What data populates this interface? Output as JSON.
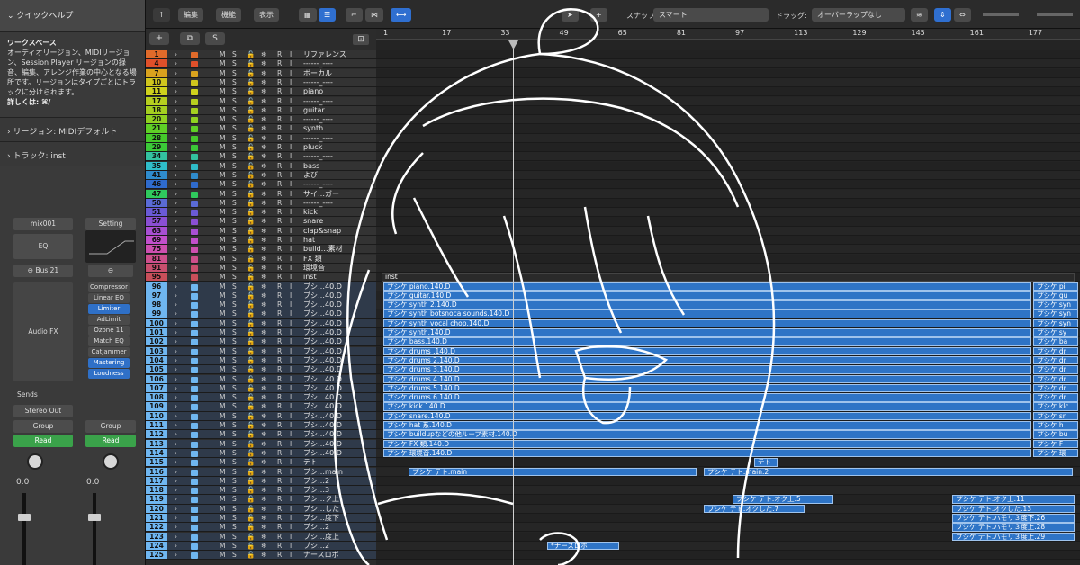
{
  "help": {
    "header": "クイックヘルプ",
    "title": "ワークスペース",
    "text": "オーディオリージョン、MIDIリージョン、Session Player リージョンの録音、編集、アレンジ作業の中心となる場所です。リージョンはタイプごとにトラックに分けられます。",
    "more": "詳しくは: ⌘/",
    "region_section": "リージョン: MIDIデフォルト",
    "track_section": "トラック: inst"
  },
  "strip1": {
    "name": "mix001",
    "eq": "EQ",
    "bus": "Bus 21",
    "fx": "Audio FX",
    "sends": "Sends",
    "out": "Stereo Out",
    "group": "Group",
    "mode": "Read",
    "value": "0.0"
  },
  "strip2": {
    "setting": "Setting",
    "plugins": [
      "Compressor",
      "Linear EQ",
      "Limiter",
      "AdLimit",
      "Ozone 11",
      "Match EQ",
      "CatJammer",
      "Mastering",
      "Loudness"
    ],
    "plugins_active": [
      false,
      false,
      true,
      false,
      false,
      false,
      false,
      true,
      true
    ],
    "group": "Group",
    "mode": "Read",
    "value": "0.0"
  },
  "toolbar": {
    "edit": "編集",
    "func": "機能",
    "view": "表示",
    "snap_label": "スナップ:",
    "snap_value": "スマート",
    "drag_label": "ドラッグ:",
    "drag_value": "オーバーラップなし"
  },
  "ruler": [
    "1",
    "17",
    "33",
    "49",
    "65",
    "81",
    "97",
    "113",
    "129",
    "145",
    "161",
    "177"
  ],
  "tracks": [
    {
      "n": "1",
      "c": "#e06a2a",
      "name": "リファレンス"
    },
    {
      "n": "4",
      "c": "#e0502a",
      "name": "------_---- "
    },
    {
      "n": "7",
      "c": "#d9a21e",
      "name": "ボーカル"
    },
    {
      "n": "10",
      "c": "#cfc51d",
      "name": "------_----"
    },
    {
      "n": "11",
      "c": "#cfd21d",
      "name": "piano"
    },
    {
      "n": "17",
      "c": "#b6cf1f",
      "name": "------_----"
    },
    {
      "n": "18",
      "c": "#a4cf20",
      "name": "guitar"
    },
    {
      "n": "20",
      "c": "#8fd021",
      "name": "------_----"
    },
    {
      "n": "21",
      "c": "#5fcf26",
      "name": "synth"
    },
    {
      "n": "28",
      "c": "#45c92b",
      "name": "------_----"
    },
    {
      "n": "29",
      "c": "#3bc938",
      "name": "pluck"
    },
    {
      "n": "34",
      "c": "#33c2a0",
      "name": "------_----"
    },
    {
      "n": "35",
      "c": "#2fbdc9",
      "name": "bass"
    },
    {
      "n": "41",
      "c": "#2f8ccd",
      "name": "よび"
    },
    {
      "n": "46",
      "c": "#2f6bcd",
      "name": "------_----"
    },
    {
      "n": "47",
      "c": "#2fc95d",
      "name": "サイ…ガー"
    },
    {
      "n": "50",
      "c": "#5a6bd6",
      "name": "------_----"
    },
    {
      "n": "51",
      "c": "#6a5ad6",
      "name": "kick"
    },
    {
      "n": "57",
      "c": "#8a4fd3",
      "name": "snare"
    },
    {
      "n": "63",
      "c": "#a84fd3",
      "name": "clap&snap"
    },
    {
      "n": "69",
      "c": "#c24fcc",
      "name": "hat"
    },
    {
      "n": "75",
      "c": "#cd4fb0",
      "name": "build…素材"
    },
    {
      "n": "81",
      "c": "#cd4f8c",
      "name": "FX 類"
    },
    {
      "n": "91",
      "c": "#c84f6e",
      "name": "環境音"
    },
    {
      "n": "95",
      "c": "#c84f5a",
      "name": "inst"
    },
    {
      "n": "96",
      "c": "#6fb6f0",
      "name": "プシ…40.D"
    },
    {
      "n": "97",
      "c": "#6fb6f0",
      "name": "プシ…40.D"
    },
    {
      "n": "98",
      "c": "#6fb6f0",
      "name": "プシ…40.D"
    },
    {
      "n": "99",
      "c": "#6fb6f0",
      "name": "プシ…40.D"
    },
    {
      "n": "100",
      "c": "#6fb6f0",
      "name": "プシ…40.D"
    },
    {
      "n": "101",
      "c": "#6fb6f0",
      "name": "プシ…40.D"
    },
    {
      "n": "102",
      "c": "#6fb6f0",
      "name": "プシ…40.D"
    },
    {
      "n": "103",
      "c": "#6fb6f0",
      "name": "プシ…40.D"
    },
    {
      "n": "104",
      "c": "#6fb6f0",
      "name": "プシ…40.D"
    },
    {
      "n": "105",
      "c": "#6fb6f0",
      "name": "プシ…40.D"
    },
    {
      "n": "106",
      "c": "#6fb6f0",
      "name": "プシ…40.D"
    },
    {
      "n": "107",
      "c": "#6fb6f0",
      "name": "プシ…40.D"
    },
    {
      "n": "108",
      "c": "#6fb6f0",
      "name": "プシ…40.D"
    },
    {
      "n": "109",
      "c": "#6fb6f0",
      "name": "プシ…40.D"
    },
    {
      "n": "110",
      "c": "#6fb6f0",
      "name": "プシ…40.D"
    },
    {
      "n": "111",
      "c": "#6fb6f0",
      "name": "プシ…40.D"
    },
    {
      "n": "112",
      "c": "#6fb6f0",
      "name": "プシ…40.D"
    },
    {
      "n": "113",
      "c": "#6fb6f0",
      "name": "プシ…40.D"
    },
    {
      "n": "114",
      "c": "#6fb6f0",
      "name": "プシ…40.D"
    },
    {
      "n": "115",
      "c": "#6fb6f0",
      "name": "テト"
    },
    {
      "n": "116",
      "c": "#6fb6f0",
      "name": "プシ…main"
    },
    {
      "n": "117",
      "c": "#6fb6f0",
      "name": "プシ…2"
    },
    {
      "n": "118",
      "c": "#6fb6f0",
      "name": "プシ…3"
    },
    {
      "n": "119",
      "c": "#6fb6f0",
      "name": "プシ…ク上"
    },
    {
      "n": "120",
      "c": "#6fb6f0",
      "name": "プシ…した"
    },
    {
      "n": "121",
      "c": "#6fb6f0",
      "name": "プシ…度下"
    },
    {
      "n": "122",
      "c": "#6fb6f0",
      "name": "プシ…2"
    },
    {
      "n": "123",
      "c": "#6fb6f0",
      "name": "プシ…度上"
    },
    {
      "n": "124",
      "c": "#6fb6f0",
      "name": "プシ…2"
    },
    {
      "n": "125",
      "c": "#6fb6f0",
      "name": "ナースロボ"
    }
  ],
  "inst_label": "inst",
  "regions": [
    "プシケ piano.140.D",
    "プシケ guitar.140.D",
    "プシケ synth 2.140.D",
    "プシケ synth botsnoca sounds.140.D",
    "プシケ synth vocal chop.140.D",
    "プシケ synth.140.D",
    "プシケ bass.140.D",
    "プシケ drums .140.D",
    "プシケ drums 2.140.D",
    "プシケ drums 3.140.D",
    "プシケ drums 4.140.D",
    "プシケ drums 5.140.D",
    "プシケ drums 6.140.D",
    "プシケ kick.140.D",
    "プシケ snare.140.D",
    "プシケ hat 系.140.D",
    "プシケ buildupなどの他ループ素材.140.D",
    "プシケ FX 類.140.D",
    "プシケ 環境音.140.D"
  ],
  "tail_regions": [
    "プシケ pi",
    "プシケ gu",
    "プシケ syn",
    "プシケ syn",
    "プシケ syn",
    "プシケ sy",
    "プシケ ba",
    "プシケ dr",
    "プシケ dr",
    "プシケ dr",
    "プシケ dr",
    "プシケ dr",
    "プシケ dr",
    "プシケ klc",
    "プシケ sn",
    "プシケ h",
    "プシケ bu",
    "プシケ F",
    "プシケ 環"
  ],
  "teto": {
    "label": "テト",
    "main": "プシケ テト.main",
    "main2": "プシケ テト.main.2",
    "oct_up5": "プシケ テト.オク上.5",
    "oct_up11": "プシケ テト.オク上.11",
    "oct_down7": "プシケ テト.オクした.7",
    "oct_down13": "プシケ テト.オクした.13",
    "harm26": "プシケ テト.ハモリ３度下.26",
    "harm28": "プシケ テト.ハモリ３度上.28",
    "harm29": "プシケ テト.ハモリ３度上.29",
    "nurse": "*ナースロボ"
  }
}
